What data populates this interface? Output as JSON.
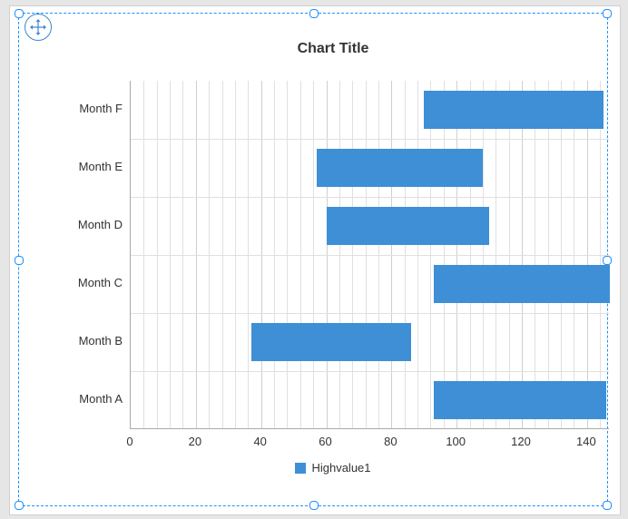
{
  "chart_data": {
    "type": "bar",
    "orientation": "horizontal",
    "title": "Chart Title",
    "categories": [
      "Month F",
      "Month E",
      "Month D",
      "Month C",
      "Month B",
      "Month A"
    ],
    "series": [
      {
        "name": "Highvalue1",
        "low": [
          90,
          57,
          60,
          93,
          37,
          93
        ],
        "high": [
          145,
          108,
          110,
          147,
          86,
          146
        ]
      }
    ],
    "x_ticks": [
      0,
      20,
      40,
      60,
      80,
      100,
      120,
      140
    ],
    "x_minor_step": 4,
    "x_max": 147,
    "xlabel": "",
    "ylabel": ""
  },
  "colors": {
    "accent": "#3e8fd6",
    "selection": "#1e90ff"
  }
}
